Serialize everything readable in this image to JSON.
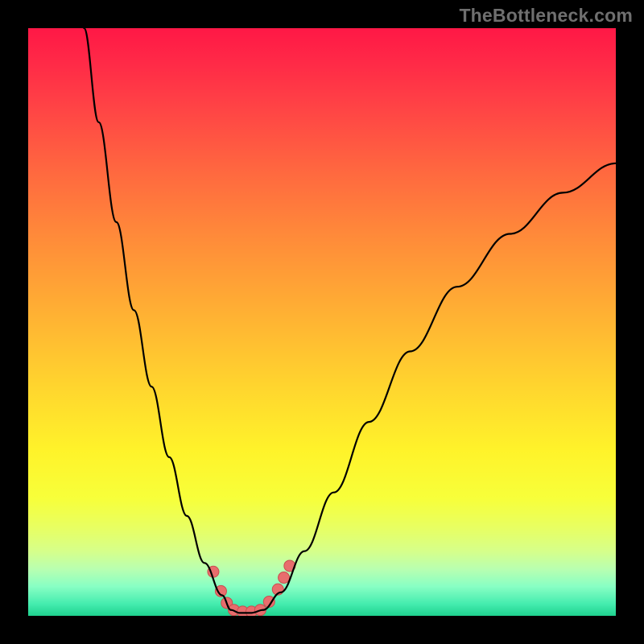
{
  "watermark": "TheBottleneck.com",
  "colors": {
    "frame": "#000000",
    "gradient_top": "#ff1846",
    "gradient_mid": "#ffd52e",
    "gradient_bottom": "#1fd18f",
    "curve": "#000000",
    "dot_fill": "#e86d6d",
    "dot_stroke": "#c94f4f"
  },
  "chart_data": {
    "type": "line",
    "title": "",
    "xlabel": "",
    "ylabel": "",
    "xlim": [
      0,
      100
    ],
    "ylim": [
      0,
      100
    ],
    "curve_left": {
      "name": "left-branch",
      "x": [
        9.5,
        12,
        15,
        18,
        21,
        24,
        27,
        30,
        33,
        34.5
      ],
      "y": [
        100,
        84,
        67,
        52,
        39,
        27,
        17,
        9,
        3.5,
        1
      ]
    },
    "curve_right": {
      "name": "right-branch",
      "x": [
        40,
        43,
        47,
        52,
        58,
        65,
        73,
        82,
        91,
        100
      ],
      "y": [
        1,
        4,
        11,
        21,
        33,
        45,
        56,
        65,
        72,
        77
      ]
    },
    "flat_bottom": {
      "name": "trough",
      "x": [
        34.5,
        36,
        38,
        40
      ],
      "y": [
        1,
        0.5,
        0.5,
        1
      ]
    },
    "series_points": [
      {
        "x": 31.5,
        "y": 7.5
      },
      {
        "x": 32.8,
        "y": 4.2
      },
      {
        "x": 33.8,
        "y": 2.2
      },
      {
        "x": 35.0,
        "y": 1.0
      },
      {
        "x": 36.5,
        "y": 0.7
      },
      {
        "x": 38.0,
        "y": 0.7
      },
      {
        "x": 39.5,
        "y": 1.0
      },
      {
        "x": 41.0,
        "y": 2.4
      },
      {
        "x": 42.5,
        "y": 4.5
      },
      {
        "x": 43.5,
        "y": 6.5
      },
      {
        "x": 44.5,
        "y": 8.5
      }
    ]
  }
}
